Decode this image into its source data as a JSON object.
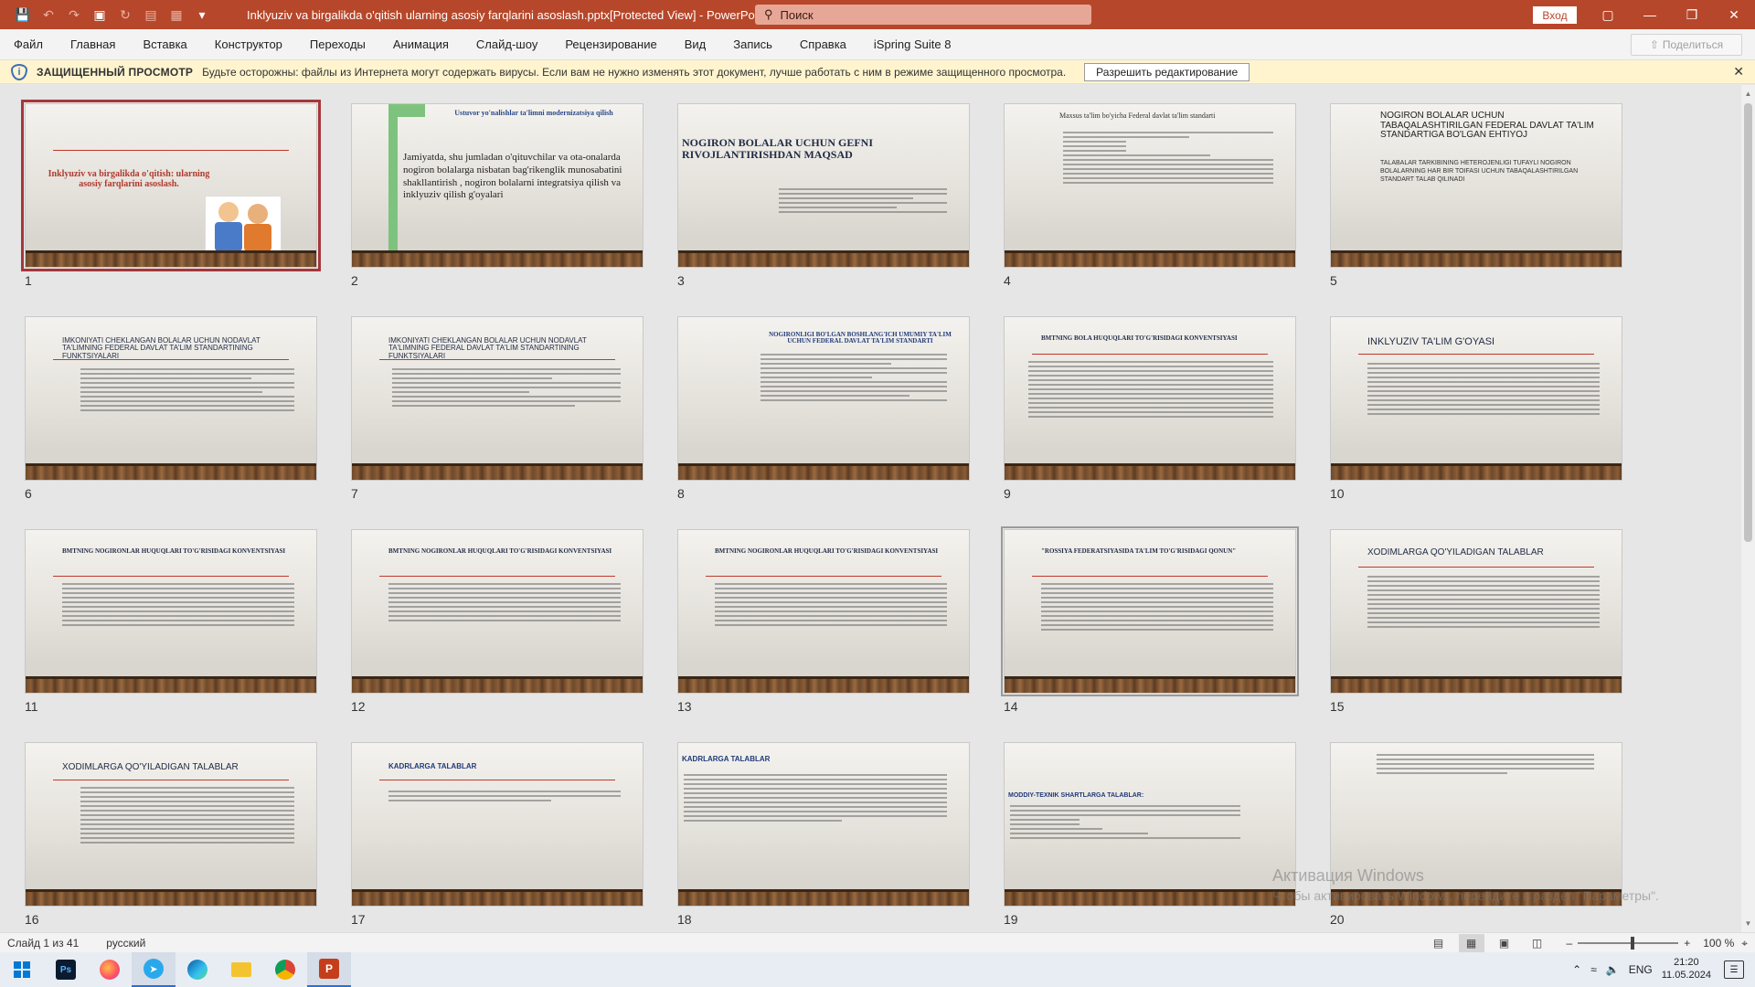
{
  "titlebar": {
    "title": "Inklyuziv va birgalikda o'qitish ularning asosiy farqlarini asoslash.pptx[Protected View]  -  PowerPoint",
    "search_placeholder": "Поиск",
    "signin": "Вход",
    "brand_color": "#b7472a"
  },
  "menu": {
    "items": [
      "Файл",
      "Главная",
      "Вставка",
      "Конструктор",
      "Переходы",
      "Анимация",
      "Слайд-шоу",
      "Рецензирование",
      "Вид",
      "Запись",
      "Справка",
      "iSpring Suite 8"
    ],
    "share": "Поделиться"
  },
  "protected_bar": {
    "title": "ЗАЩИЩЕННЫЙ ПРОСМОТР",
    "message": "Будьте осторожны: файлы из Интернета могут содержать вирусы. Если вам не нужно изменять этот документ, лучше работать с ним в режиме защищенного просмотра.",
    "enable_button": "Разрешить редактирование"
  },
  "slides": [
    {
      "num": "1",
      "title": "Inklyuziv va birgalikda o'qitish: ularning asosiy farqlarini asoslash."
    },
    {
      "num": "2",
      "title": "Ustuvor yo'nalishlar ta'limni modernizatsiya qilish",
      "body": "Jamiyatda, shu jumladan o'qituvchilar va ota-onalarda nogiron bolalarga nisbatan bag'rikenglik munosabatini shakllantirish , nogiron bolalarni integratsiya qilish va inklyuziv qilish g'oyalari"
    },
    {
      "num": "3",
      "title": "NOGIRON BOLALAR UCHUN GEFNI RIVOJLANTIRISHDAN MAQSAD"
    },
    {
      "num": "4",
      "body": "Maxsus ta'lim bo'yicha Federal davlat ta'lim standarti"
    },
    {
      "num": "5",
      "title": "NOGIRON BOLALAR UCHUN TABAQALASHTIRILGAN FEDERAL DAVLAT TA'LIM STANDARTIGA BO'LGAN EHTIYOJ",
      "body": "TALABALAR TARKIBINING HETEROJENLIGI TUFAYLI NOGIRON BOLALARNING HAR BIR TOIFASI UCHUN TABAQALASHTIRILGAN STANDART TALAB QILINADI"
    },
    {
      "num": "6",
      "title": "IMKONIYATI CHEKLANGAN BOLALAR UCHUN NODAVLAT TA'LIMNING FEDERAL DAVLAT TA'LIM STANDARTINING FUNKTSIYALARI"
    },
    {
      "num": "7",
      "title": "IMKONIYATI CHEKLANGAN BOLALAR UCHUN NODAVLAT TA'LIMNING FEDERAL DAVLAT TA'LIM STANDARTINING FUNKTSIYALARI"
    },
    {
      "num": "8",
      "title": "NOGIRONLIGI BO'LGAN BOSHLANG'ICH UMUMIY TA'LIM UCHUN FEDERAL DAVLAT TA'LIM STANDARTI"
    },
    {
      "num": "9",
      "title": "BMTNING BOLA HUQUQLARI TO'G'RISIDAGI KONVENTSIYASI"
    },
    {
      "num": "10",
      "title": "INKLYUZIV TA'LIM G'OYASI"
    },
    {
      "num": "11",
      "title": "BMTNING NOGIRONLAR HUQUQLARI TO'G'RISIDAGI KONVENTSIYASI"
    },
    {
      "num": "12",
      "title": "BMTNING NOGIRONLAR HUQUQLARI TO'G'RISIDAGI KONVENTSIYASI"
    },
    {
      "num": "13",
      "title": "BMTNING NOGIRONLAR HUQUQLARI TO'G'RISIDAGI KONVENTSIYASI"
    },
    {
      "num": "14",
      "title": "\"ROSSIYA FEDERATSIYASIDA TA'LIM TO'G'RISIDAGI QONUN\""
    },
    {
      "num": "15",
      "title": "XODIMLARGA QO'YILADIGAN TALABLAR"
    },
    {
      "num": "16",
      "title": "XODIMLARGA QO'YILADIGAN TALABLAR"
    },
    {
      "num": "17",
      "title": "KADRLARGA TALABLAR"
    },
    {
      "num": "18",
      "title": "KADRLARGA TALABLAR"
    },
    {
      "num": "19",
      "title": "MODDIY-TEXNIK SHARTLARGA TALABLAR:"
    },
    {
      "num": "20"
    }
  ],
  "status": {
    "slide_info": "Слайд 1 из 41",
    "language": "русский",
    "zoom": "100 %"
  },
  "watermark": {
    "line1": "Активация Windows",
    "line2": "Чтобы активировать Windows, перейдите в раздел \"Параметры\"."
  },
  "taskbar": {
    "lang": "ENG",
    "time": "21:20",
    "date": "11.05.2024"
  }
}
